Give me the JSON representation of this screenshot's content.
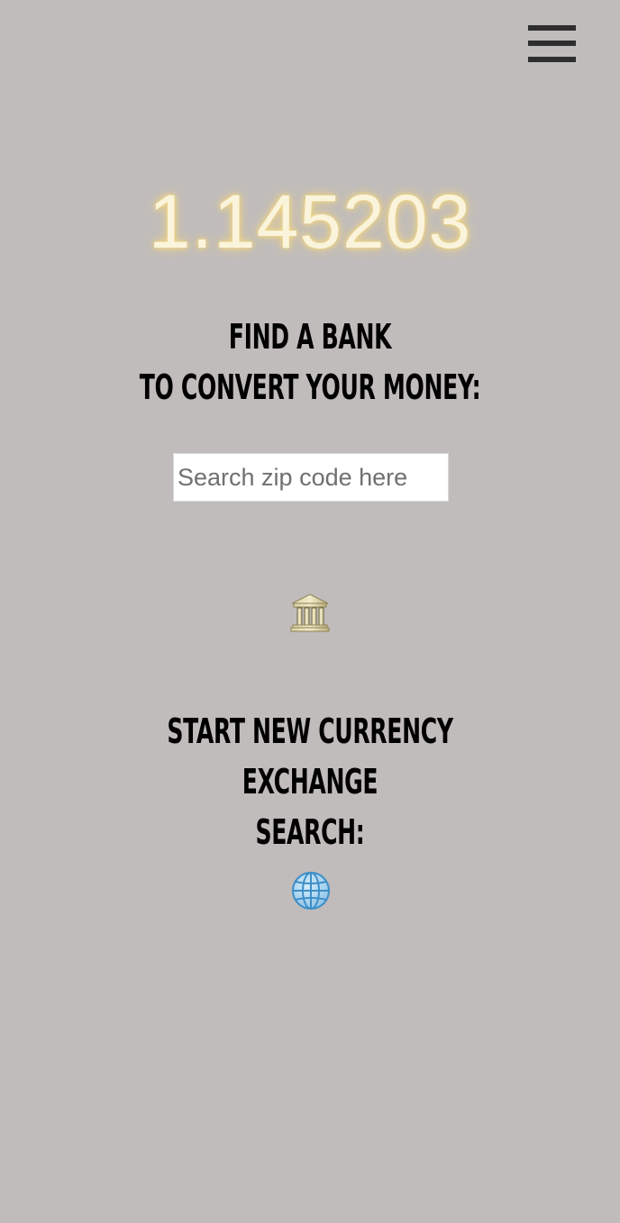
{
  "header": {
    "menu_icon": "hamburger-menu-icon"
  },
  "rate": {
    "value": "1.145203"
  },
  "find_bank": {
    "heading_line1": "FIND A BANK",
    "heading_line2": "TO CONVERT YOUR MONEY:",
    "search_placeholder": "Search zip code here",
    "search_value": "",
    "icon": "bank-building-icon"
  },
  "new_search": {
    "heading_line1": "START NEW CURRENCY EXCHANGE",
    "heading_line2": "SEARCH:",
    "icon": "globe-icon"
  },
  "colors": {
    "background": "#c0bcbb",
    "rate_text": "#fbf4dc",
    "rate_glow": "#efd37f",
    "heading_text": "#000000",
    "menu_bars": "#2e2e2e"
  }
}
